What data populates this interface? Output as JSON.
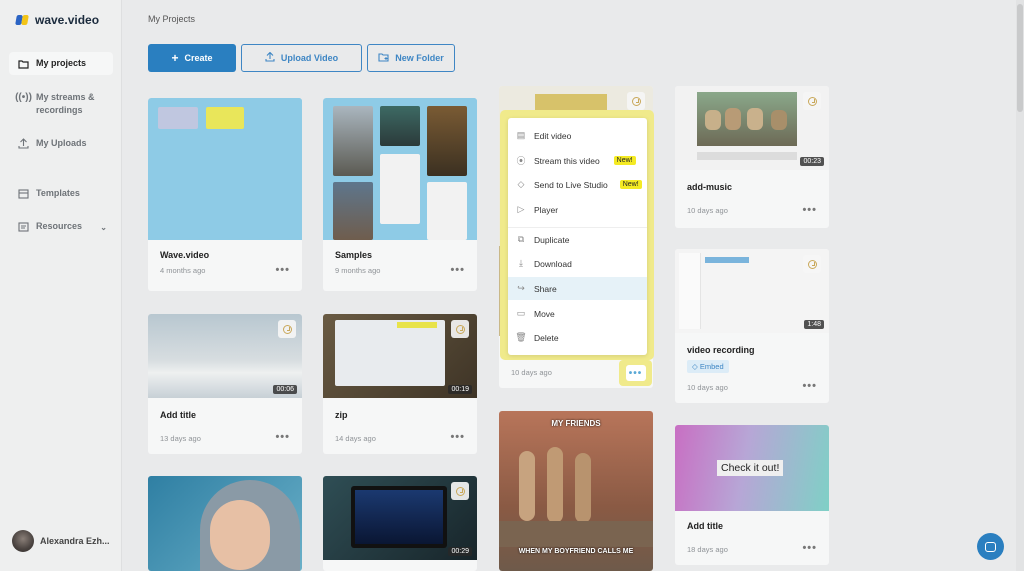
{
  "app": {
    "name": "wave.video"
  },
  "sidebar": {
    "items": [
      {
        "label": "My projects",
        "icon": "folder-icon"
      },
      {
        "label": "My streams & recordings",
        "icon": "broadcast-icon"
      },
      {
        "label": "My Uploads",
        "icon": "upload-icon"
      },
      {
        "label": "Templates",
        "icon": "templates-icon"
      },
      {
        "label": "Resources",
        "icon": "resources-icon"
      }
    ],
    "user_name": "Alexandra Ezh..."
  },
  "main": {
    "title": "My Projects",
    "toolbar": {
      "create": "Create",
      "upload": "Upload Video",
      "new_folder": "New Folder"
    },
    "projects": [
      {
        "title": "Wave.video",
        "date": "4 months ago"
      },
      {
        "title": "Samples",
        "date": "9 months ago"
      },
      {
        "title": "add-music",
        "date": "10 days ago",
        "duration": "00:23"
      },
      {
        "title": "Add title",
        "date": "13 days ago",
        "duration": "00:06"
      },
      {
        "title": "zip",
        "date": "14 days ago",
        "duration": "00:19"
      },
      {
        "title": "",
        "date": "10 days ago"
      },
      {
        "title": "video recording",
        "date": "10 days ago",
        "duration": "1:48",
        "badge": "Embed"
      },
      {
        "title": "Add title",
        "date": "18 days ago",
        "thumb_text": "Check it out!"
      },
      {
        "duration": "00:29"
      },
      {
        "meme_top": "MY FRIENDS",
        "meme_bottom": "WHEN MY BOYFRIEND CALLS ME"
      }
    ],
    "more_label": "•••"
  },
  "context_menu": {
    "items": [
      {
        "label": "Edit video",
        "icon": "edit-icon"
      },
      {
        "label": "Stream this video",
        "icon": "broadcast-icon",
        "badge": "New!"
      },
      {
        "label": "Send to Live Studio",
        "icon": "tag-icon",
        "badge": "New!"
      },
      {
        "label": "Player",
        "icon": "play-icon"
      },
      {
        "label": "Duplicate",
        "icon": "duplicate-icon"
      },
      {
        "label": "Download",
        "icon": "download-icon"
      },
      {
        "label": "Share",
        "icon": "share-icon"
      },
      {
        "label": "Move",
        "icon": "folder-icon"
      },
      {
        "label": "Delete",
        "icon": "trash-icon"
      }
    ],
    "highlight_color": "#f0ea8b",
    "active_item": "Share"
  },
  "colors": {
    "accent": "#2a7fc0",
    "badge_yellow": "#f4ea23",
    "folder_blue": "#8ecbe6"
  }
}
